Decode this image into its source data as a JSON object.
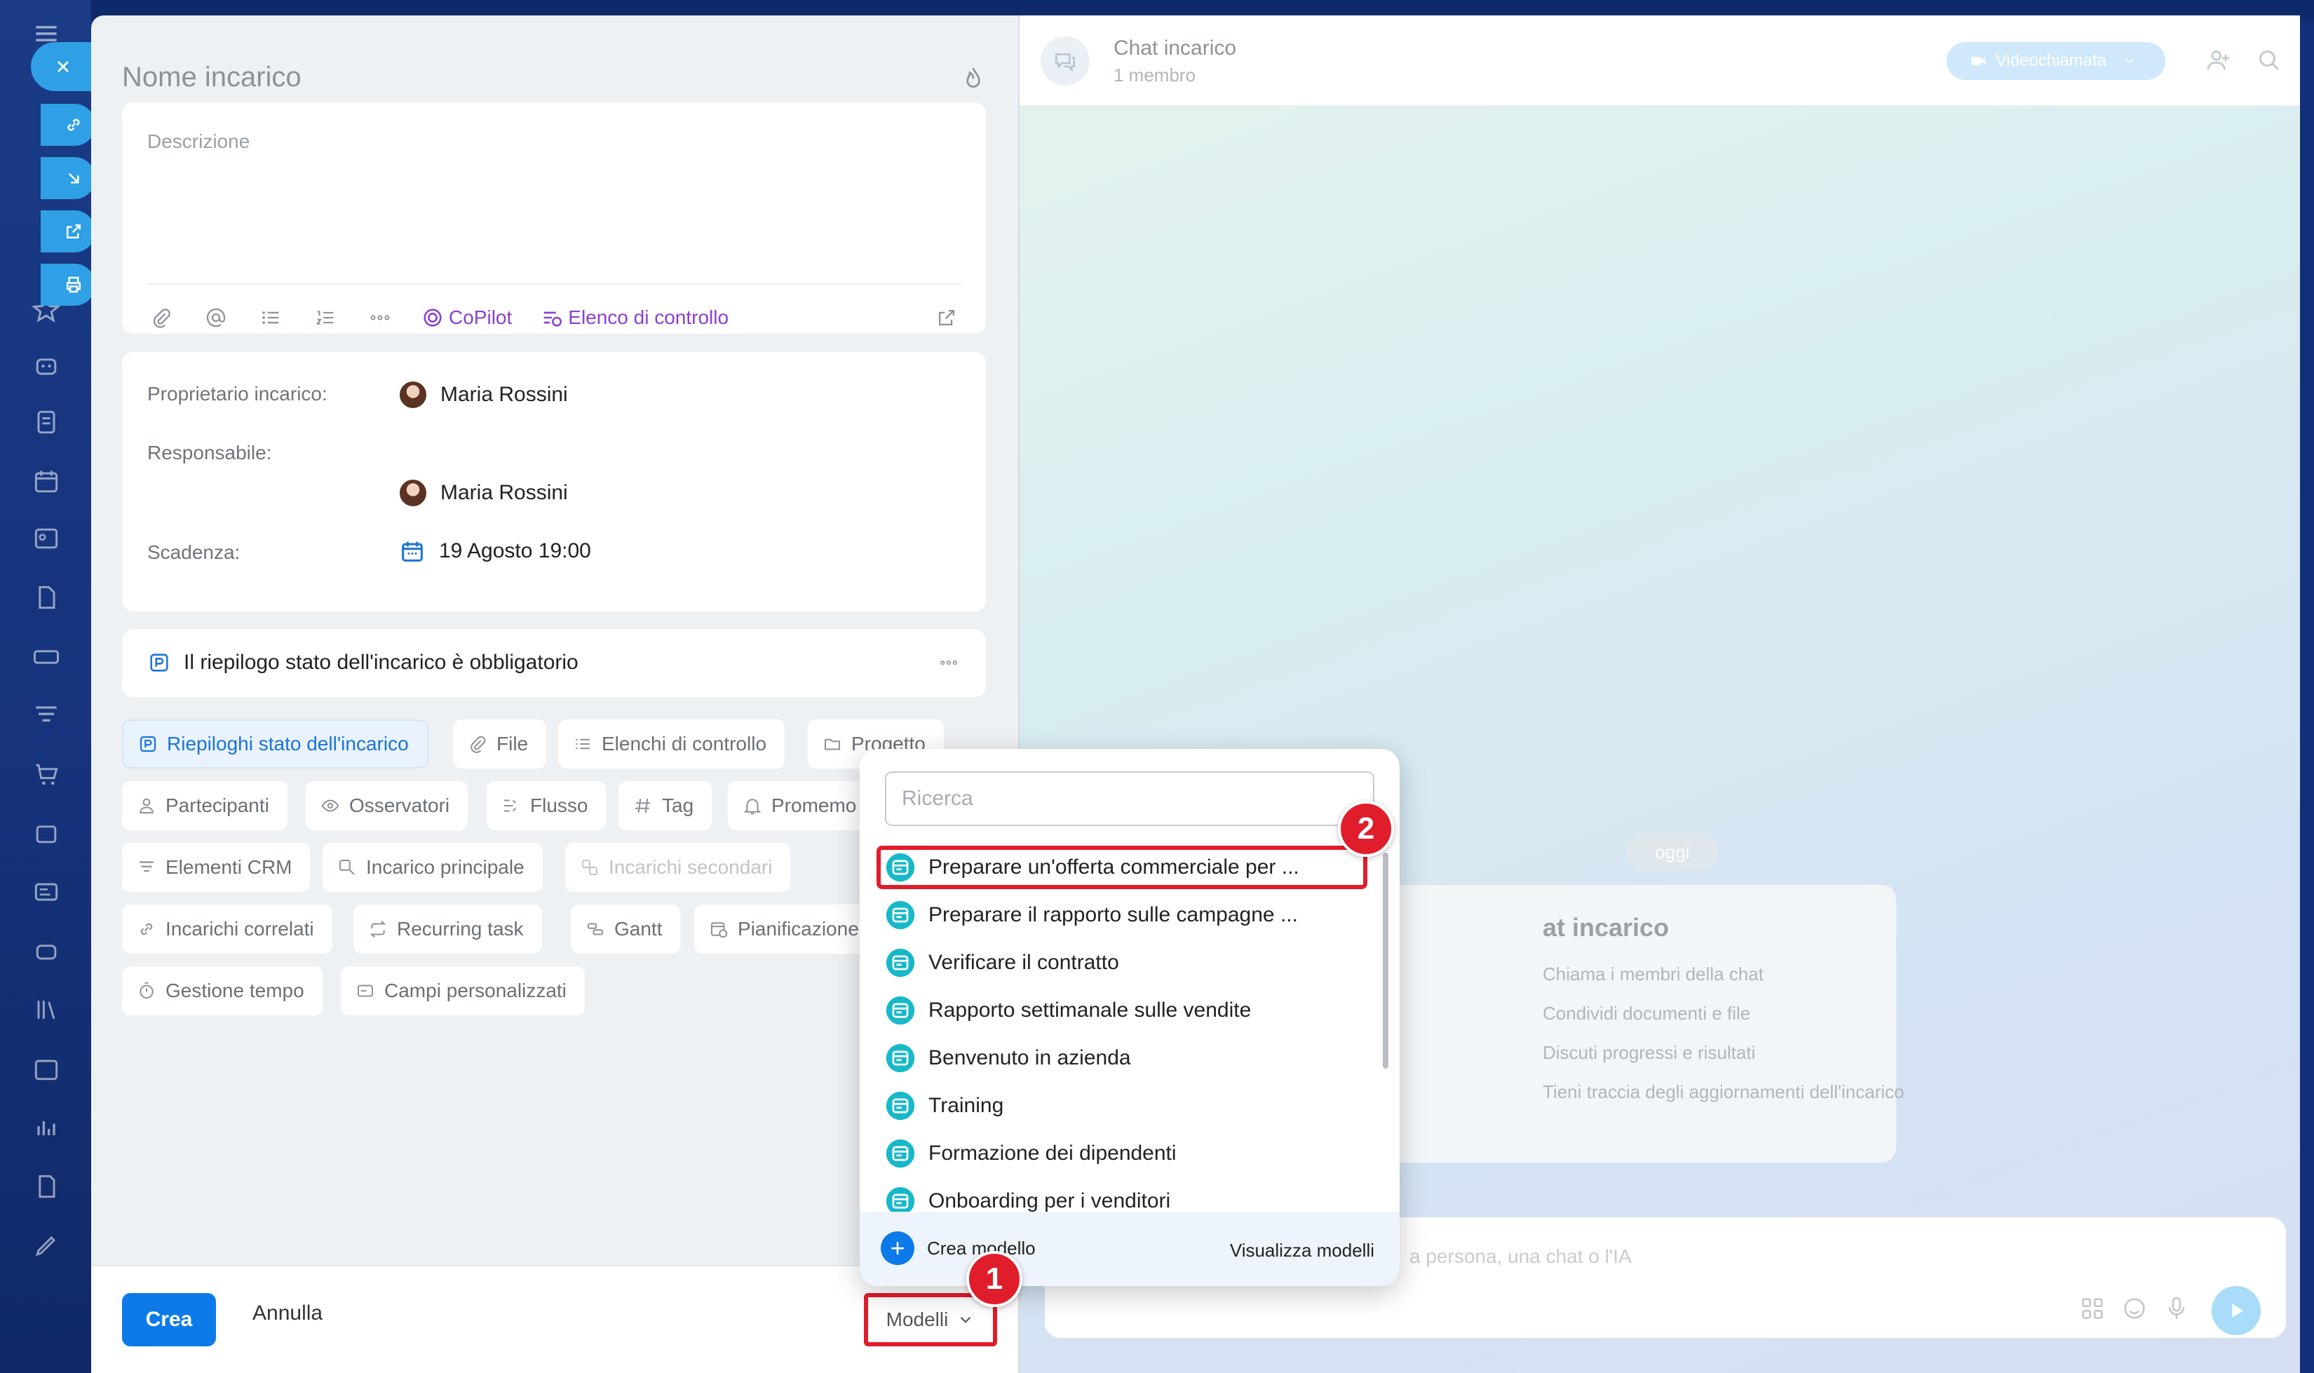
{
  "form": {
    "title": "Nome incarico",
    "description_placeholder": "Descrizione",
    "toolbar": {
      "copilot": "CoPilot",
      "checklist": "Elenco di controllo"
    },
    "owner_label": "Proprietario incarico:",
    "owner_name": "Maria Rossini",
    "assignee_label": "Responsabile:",
    "assignee_name": "Maria Rossini",
    "deadline_label": "Scadenza:",
    "deadline_value": "19 Agosto 19:00",
    "summary_text": "Il riepilogo stato dell'incarico è obbligatorio",
    "chips": [
      {
        "label": "Riepiloghi stato dell'incarico",
        "icon": "summary-icon",
        "active": true
      },
      {
        "label": "File",
        "icon": "paperclip-icon"
      },
      {
        "label": "Elenchi di controllo",
        "icon": "checklist-icon"
      },
      {
        "label": "Progetto",
        "icon": "folder-icon"
      },
      {
        "label": "Partecipanti",
        "icon": "person-icon"
      },
      {
        "label": "Osservatori",
        "icon": "eye-icon"
      },
      {
        "label": "Flusso",
        "icon": "flow-icon"
      },
      {
        "label": "Tag",
        "icon": "hash-icon"
      },
      {
        "label": "Promemo",
        "icon": "bell-icon"
      },
      {
        "label": "Elementi CRM",
        "icon": "crm-icon"
      },
      {
        "label": "Incarico principale",
        "icon": "parent-task-icon"
      },
      {
        "label": "Incarichi secondari",
        "icon": "subtask-icon",
        "disabled": true
      },
      {
        "label": "Incarichi correlati",
        "icon": "link-icon"
      },
      {
        "label": "Recurring task",
        "icon": "repeat-icon"
      },
      {
        "label": "Gantt",
        "icon": "gantt-icon"
      },
      {
        "label": "Pianificazione",
        "icon": "calendar-clock-icon"
      },
      {
        "label": "Gestione tempo",
        "icon": "timer-icon"
      },
      {
        "label": "Campi personalizzati",
        "icon": "fields-icon"
      }
    ],
    "footer": {
      "create": "Crea",
      "cancel": "Annulla",
      "templates": "Modelli"
    }
  },
  "chat": {
    "title": "Chat incarico",
    "members": "1 membro",
    "video_button": "Videochiamata",
    "today": "oggi",
    "info_title": "at incarico",
    "info_items": [
      "Chiama i membri della chat",
      "Condividi documenti e file",
      "Discuti progressi e risultati",
      "Tieni traccia degli aggiornamenti dell'incarico"
    ],
    "composer_placeholder": "a persona, una chat o l'IA"
  },
  "templates_dropdown": {
    "search_placeholder": "Ricerca",
    "items": [
      "Preparare un'offerta commerciale per ...",
      "Preparare il rapporto sulle campagne ...",
      "Verificare il contratto",
      "Rapporto settimanale sulle vendite",
      "Benvenuto in azienda",
      "Training",
      "Formazione dei dipendenti",
      "Onboarding per i venditori"
    ],
    "highlighted_index": 0,
    "create_template": "Crea modello",
    "view_templates": "Visualizza modelli"
  },
  "annotations": {
    "step1": "1",
    "step2": "2"
  },
  "colors": {
    "accent": "#0d7aea",
    "highlight": "#e01d2b",
    "copilot": "#8a3fd1",
    "template_icon": "#17b8c8"
  }
}
